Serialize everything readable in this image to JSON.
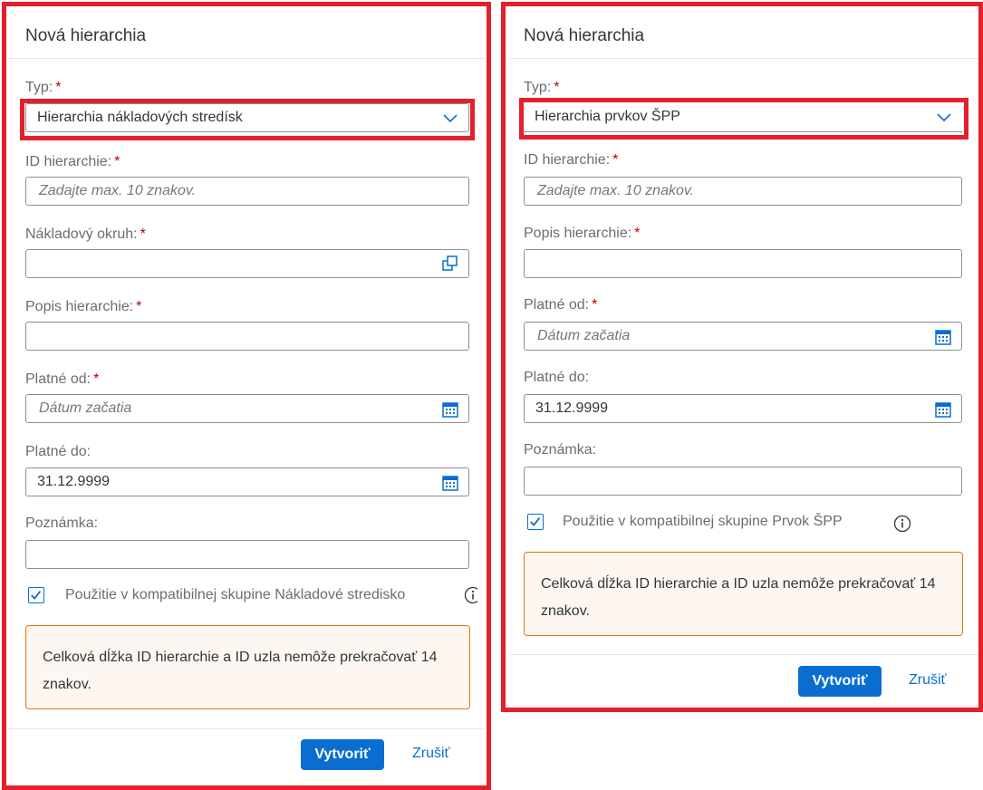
{
  "left": {
    "title": "Nová hierarchia",
    "type_label": "Typ:",
    "type_value": "Hierarchia nákladových stredísk",
    "id_label": "ID hierarchie:",
    "id_placeholder": "Zadajte max. 10 znakov.",
    "cost_area_label": "Nákladový okruh:",
    "desc_label": "Popis hierarchie:",
    "valid_from_label": "Platné od:",
    "valid_from_placeholder": "Dátum začatia",
    "valid_to_label": "Platné do:",
    "valid_to_value": "31.12.9999",
    "note_label": "Poznámka:",
    "checkbox_label": "Použitie v kompatibilnej skupine Nákladové stredisko",
    "checkbox_checked": true,
    "message": "Celková dĺžka ID hierarchie a ID uzla nemôže prekračovať 14 znakov.",
    "create_label": "Vytvoriť",
    "cancel_label": "Zrušiť"
  },
  "right": {
    "title": "Nová hierarchia",
    "type_label": "Typ:",
    "type_value": "Hierarchia prvkov ŠPP",
    "id_label": "ID hierarchie:",
    "id_placeholder": "Zadajte max. 10 znakov.",
    "desc_label": "Popis hierarchie:",
    "valid_from_label": "Platné od:",
    "valid_from_placeholder": "Dátum začatia",
    "valid_to_label": "Platné do:",
    "valid_to_value": "31.12.9999",
    "note_label": "Poznámka:",
    "checkbox_label": "Použitie v kompatibilnej skupine Prvok ŠPP",
    "checkbox_checked": true,
    "message": "Celková dĺžka ID hierarchie a ID uzla nemôže prekračovať 14 znakov.",
    "create_label": "Vytvoriť",
    "cancel_label": "Zrušiť"
  },
  "required_marker": "*",
  "colors": {
    "accent": "#0a6ed1",
    "highlight_frame": "#e4202a",
    "required": "#bb0000",
    "warning_border": "#e9730c",
    "warning_bg": "#fef7f1"
  }
}
